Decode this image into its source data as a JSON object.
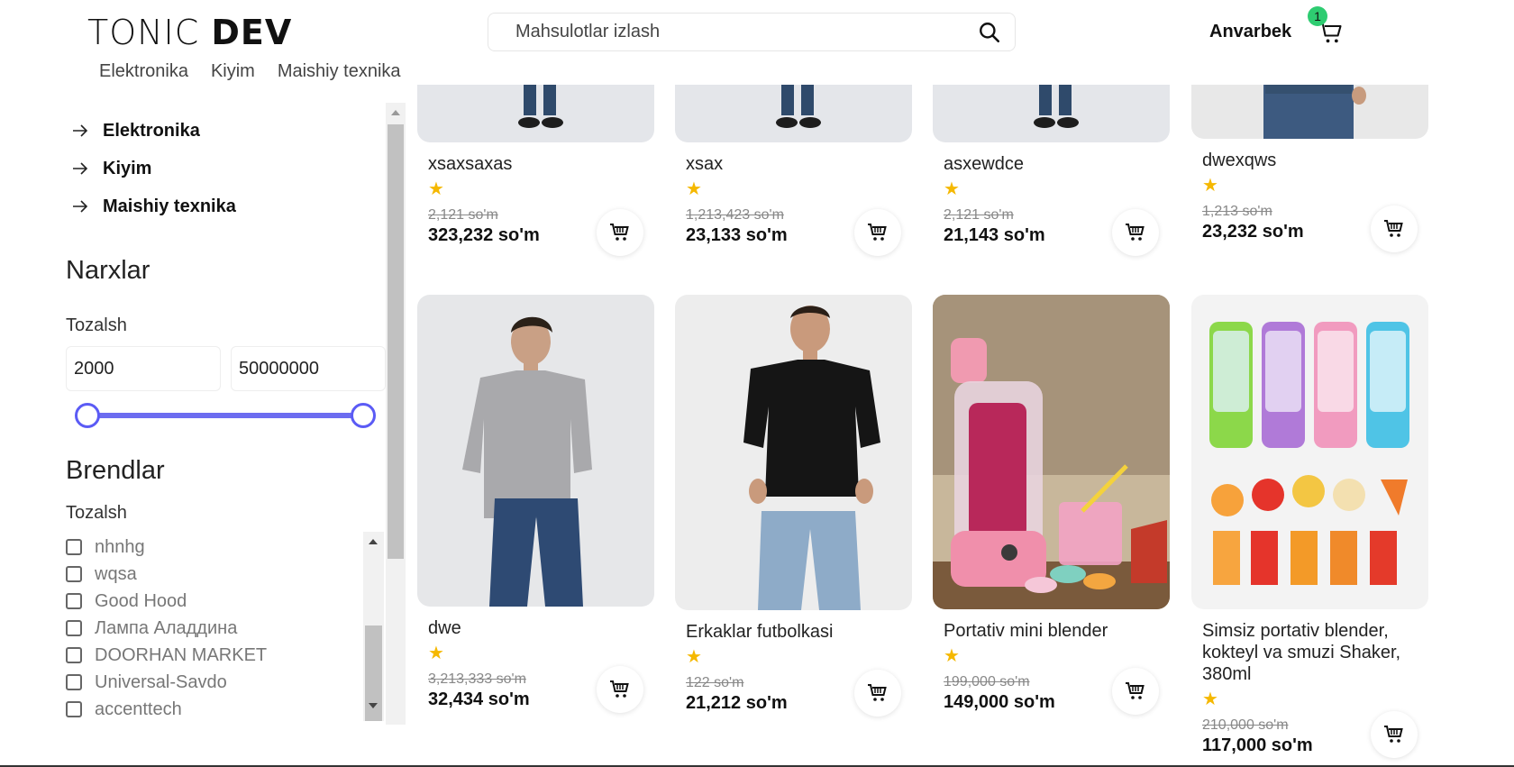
{
  "header": {
    "logo_light": "TONIC",
    "logo_bold": "DEV",
    "search_placeholder": "Mahsulotlar izlash",
    "user_name": "Anvarbek",
    "cart_count": "1"
  },
  "top_nav": [
    "Elektronika",
    "Kiyim",
    "Maishiy texnika"
  ],
  "sidebar": {
    "categories": [
      "Elektronika",
      "Kiyim",
      "Maishiy texnika"
    ],
    "prices_title": "Narxlar",
    "prices_clear": "Tozalsh",
    "price_min": "2000",
    "price_max": "50000000",
    "brands_title": "Brendlar",
    "brands_clear": "Tozalsh",
    "brands": [
      "nhnhg",
      "wqsa",
      "Good Hood",
      "Лампа Аладдина",
      "DOORHAN MARKET",
      "Universal-Savdo",
      "accenttech"
    ]
  },
  "products": [
    {
      "name": "xsaxsaxas",
      "old_price": "2,121 so'm",
      "price": "323,232 so'm",
      "rating": 1
    },
    {
      "name": "xsax",
      "old_price": "1,213,423 so'm",
      "price": "23,133 so'm",
      "rating": 1
    },
    {
      "name": "asxewdce",
      "old_price": "2,121 so'm",
      "price": "21,143 so'm",
      "rating": 1
    },
    {
      "name": "dwexqws",
      "old_price": "1,213 so'm",
      "price": "23,232 so'm",
      "rating": 1
    },
    {
      "name": "dwe",
      "old_price": "3,213,333 so'm",
      "price": "32,434 so'm",
      "rating": 1
    },
    {
      "name": "Erkaklar futbolkasi",
      "old_price": "122 so'm",
      "price": "21,212 so'm",
      "rating": 1
    },
    {
      "name": "Portativ mini blender",
      "old_price": "199,000 so'm",
      "price": "149,000 so'm",
      "rating": 1
    },
    {
      "name": "Simsiz portativ blender, kokteyl va smuzi Shaker, 380ml",
      "old_price": "210,000 so'm",
      "price": "117,000 so'm",
      "rating": 1
    }
  ],
  "colors": {
    "accent": "#5b5bf5",
    "badge": "#2ecc71",
    "star": "#f5b800"
  }
}
